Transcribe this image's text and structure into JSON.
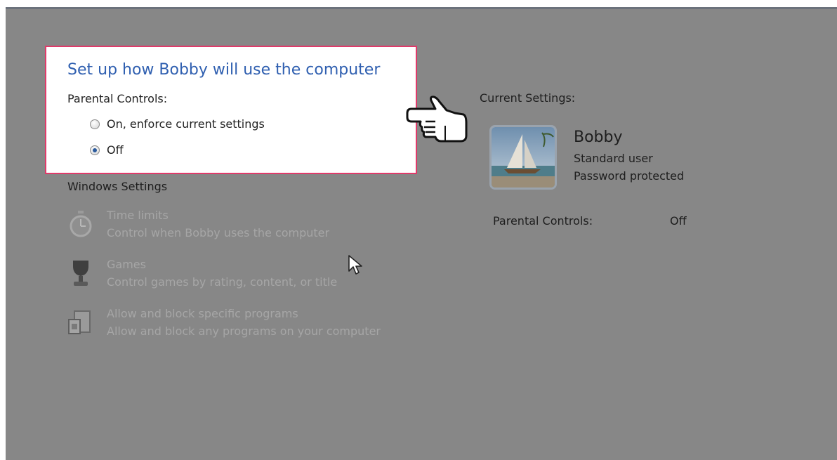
{
  "setup": {
    "title": "Set up how Bobby will use the computer",
    "parental_controls_label": "Parental Controls:",
    "options": [
      {
        "label": "On, enforce current settings",
        "selected": false
      },
      {
        "label": "Off",
        "selected": true
      }
    ]
  },
  "windows_settings": {
    "heading": "Windows Settings",
    "items": [
      {
        "title": "Time limits",
        "description": "Control when Bobby uses the computer",
        "icon": "stopwatch-icon"
      },
      {
        "title": "Games",
        "description": "Control games by rating, content, or title",
        "icon": "trophy-icon"
      },
      {
        "title": "Allow and block specific programs",
        "description": "Allow and block any programs on your computer",
        "icon": "programs-icon"
      }
    ]
  },
  "current_settings": {
    "heading": "Current Settings:",
    "user_name": "Bobby",
    "account_type": "Standard user",
    "password_status": "Password protected",
    "parental_controls_label": "Parental Controls:",
    "parental_controls_value": "Off"
  },
  "colors": {
    "highlight_border": "#e03a6a",
    "title_blue": "#2f5fb0",
    "overlay_gray": "#878787"
  }
}
